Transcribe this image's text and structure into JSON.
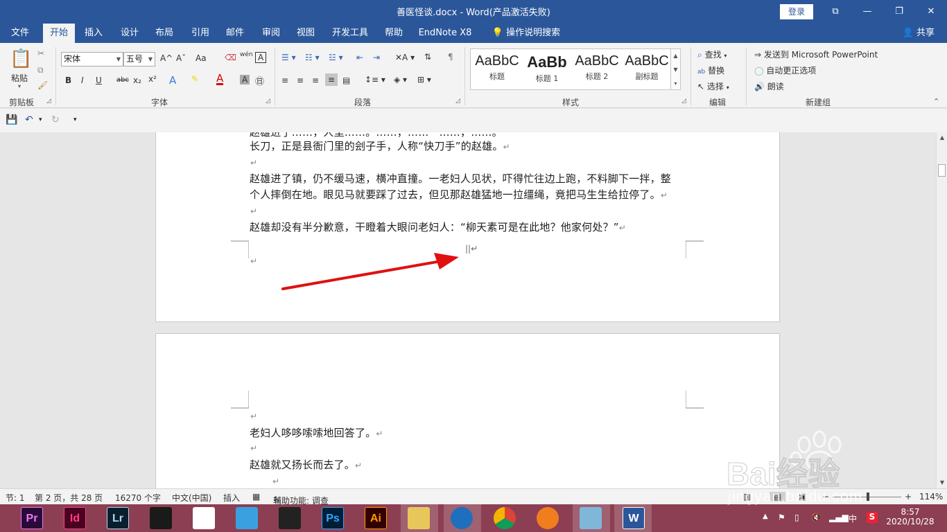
{
  "window": {
    "title": "善医怪谈.docx  -  Word(产品激活失败)",
    "login_label": "登录",
    "minimize_icon": "—",
    "restore_icon": "❐",
    "close_icon": "✕",
    "ribbon_display_icon": "⧉"
  },
  "tabs": [
    {
      "label": "文件"
    },
    {
      "label": "开始"
    },
    {
      "label": "插入"
    },
    {
      "label": "设计"
    },
    {
      "label": "布局"
    },
    {
      "label": "引用"
    },
    {
      "label": "邮件"
    },
    {
      "label": "审阅"
    },
    {
      "label": "视图"
    },
    {
      "label": "开发工具"
    },
    {
      "label": "帮助"
    },
    {
      "label": "EndNote X8"
    },
    {
      "label": "操作说明搜索"
    }
  ],
  "share_label": "共享",
  "ribbon": {
    "clipboard": {
      "paste_label": "粘贴",
      "group_label": "剪贴板"
    },
    "font": {
      "font_name": "宋体",
      "font_size": "五号",
      "group_label": "字体",
      "bold": "B",
      "italic": "I",
      "underline": "U",
      "strike": "abc",
      "subscript": "x₂",
      "superscript": "x²",
      "aa": "Aa",
      "grow": "A^",
      "shrink": "Aˇ",
      "pinyin": "wén",
      "border_char": "A"
    },
    "paragraph": {
      "group_label": "段落"
    },
    "styles": {
      "group_label": "样式",
      "items": [
        {
          "sample": "AaBbC",
          "name": "标题"
        },
        {
          "sample": "AaBb",
          "name": "标题 1"
        },
        {
          "sample": "AaBbC",
          "name": "标题 2"
        },
        {
          "sample": "AaBbC",
          "name": "副标题"
        }
      ]
    },
    "editing": {
      "group_label": "编辑",
      "find": "查找",
      "replace": "替换",
      "select": "选择"
    },
    "newgroup": {
      "group_label": "新建组",
      "send_ppt": "发送到 Microsoft PowerPoint",
      "autocorrect": "自动更正选项",
      "read_aloud": "朗读"
    }
  },
  "document": {
    "page1_lines": [
      "长刀，正是县衙门里的刽子手，人称“快刀手”的赵雄。",
      "赵雄进了镇，仍不缓马速，横冲直撞。一老妇人见状，吓得忙往边上跑，不料脚下一拌，整",
      "个人摔倒在地。眼见马就要踩了过去，但见那赵雄猛地一拉缰绳，竟把马生生给拉停了。",
      "赵雄却没有半分歉意，干瞪着大眼问老妇人：“柳天素可是在此地？他家何处？”"
    ],
    "page1_top_partial": "赵雄进了……，人里……。……，……一……，……。",
    "page2_lines": [
      "老妇人哆哆嗦嗦地回答了。",
      "赵雄就又扬长而去了。"
    ],
    "para_mark": "↵",
    "cursor_mark": "||↵"
  },
  "statusbar": {
    "section": "节: 1",
    "page": "第 2 页，共 28 页",
    "words": "16270 个字",
    "language": "中文(中国)",
    "mode": "插入",
    "accessibility": "辅助功能: 调查",
    "zoom": "114%",
    "zoom_minus": "−",
    "zoom_plus": "+"
  },
  "taskbar": {
    "apps": [
      {
        "name": "Pr",
        "color": "#2a0a3a",
        "fg": "#e77cf5"
      },
      {
        "name": "Id",
        "color": "#49021f",
        "fg": "#ff3d8b"
      },
      {
        "name": "Lr",
        "color": "#0a1f2e",
        "fg": "#add5ec"
      },
      {
        "name": "",
        "color": "#1a1a1a",
        "fg": "#ffffff"
      },
      {
        "name": "",
        "color": "#ffffff",
        "fg": "#d42a2a"
      },
      {
        "name": "",
        "color": "#3aa0e0",
        "fg": "#ffffff"
      },
      {
        "name": "",
        "color": "#222222",
        "fg": "#ffffff"
      },
      {
        "name": "Ps",
        "color": "#001e36",
        "fg": "#31a8ff"
      },
      {
        "name": "Ai",
        "color": "#330000",
        "fg": "#ff9a00"
      },
      {
        "name": "",
        "color": "#e8c75a",
        "fg": "#ffffff"
      },
      {
        "name": "",
        "color": "#1f6fbf",
        "fg": "#ffffff"
      },
      {
        "name": "",
        "color": "#ffffff",
        "fg": "#ffffff"
      },
      {
        "name": "",
        "color": "#f07e1e",
        "fg": "#ffffff"
      },
      {
        "name": "",
        "color": "#7fb7d9",
        "fg": "#ffffff"
      },
      {
        "name": "W",
        "color": "#2b579a",
        "fg": "#ffffff"
      }
    ],
    "ime": "中",
    "time": "8:57",
    "date": "2020/10/28"
  },
  "watermark": {
    "text": "Bai经验",
    "url": "jingyan.baidu.com"
  }
}
